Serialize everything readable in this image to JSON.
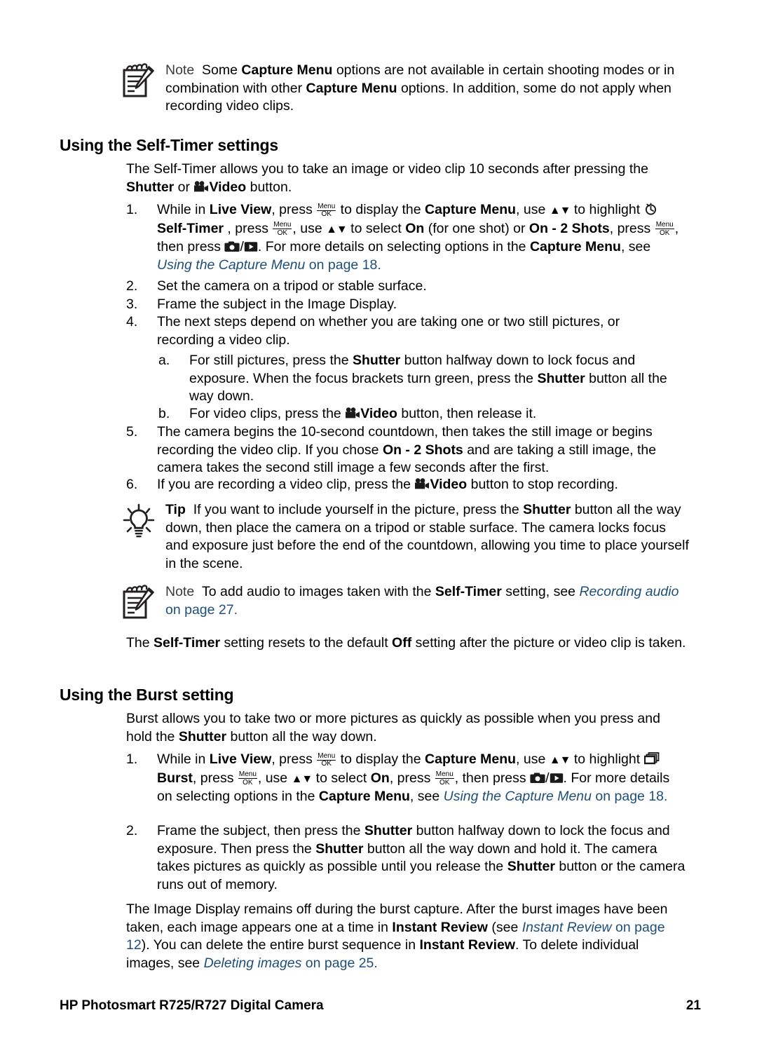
{
  "document": {
    "footer_title": "HP Photosmart R725/R727 Digital Camera",
    "page_number": "21",
    "link_color": "#1f4e79"
  },
  "note_top": {
    "icon": "note-pad-pencil-icon",
    "label": "Note",
    "text_1": "Some ",
    "bold_1": "Capture Menu",
    "text_2": " options are not available in certain shooting modes or in combination with other ",
    "bold_2": "Capture Menu",
    "text_3": " options. In addition, some do not apply when recording video clips."
  },
  "section_self_timer": {
    "heading": "Using the Self-Timer settings",
    "intro": {
      "text_1": "The Self-Timer allows you to take an image or video clip 10 seconds after pressing the ",
      "bold_1": "Shutter",
      "text_2": " or ",
      "video_icon": "video-camera-icon",
      "bold_2": "Video",
      "text_3": " button."
    },
    "steps": [
      {
        "marker": "1.",
        "parts": {
          "t1": "While in ",
          "b1": "Live View",
          "t2": ", press ",
          "menu_icon": {
            "top": "Menu",
            "bottom": "OK"
          },
          "t3": " to display the ",
          "b2": "Capture Menu",
          "t4": ", use ",
          "arrows": "▲▼",
          "t5": " to highlight ",
          "selftimer_icon": "stopwatch-self-timer-icon",
          "b3": "Self-Timer",
          "t6": " , press ",
          "t7": ", use ",
          "t8": " to select ",
          "b4": "On",
          "t9": " (for one shot) or ",
          "b5": "On - 2 Shots",
          "t10": ", press ",
          "t11": ", then press ",
          "camera_icon": "still-camera-icon",
          "slash": "/",
          "playback_icon": "playback-icon",
          "t12": ". For more details on selecting options in the ",
          "b6": "Capture Menu",
          "t13": ", see ",
          "link": "Using the Capture Menu",
          "t14": " on page 18."
        }
      },
      {
        "marker": "2.",
        "text": "Set the camera on a tripod or stable surface."
      },
      {
        "marker": "3.",
        "text": "Frame the subject in the Image Display."
      },
      {
        "marker": "4.",
        "text": "The next steps depend on whether you are taking one or two still pictures, or recording a video clip."
      }
    ],
    "substeps": [
      {
        "marker": "a.",
        "t1": "For still pictures, press the ",
        "b1": "Shutter",
        "t2": " button halfway down to lock focus and exposure. When the focus brackets turn green, press the ",
        "b2": "Shutter",
        "t3": " button all the way down."
      },
      {
        "marker": "b.",
        "t1": "For video clips, press the ",
        "video_icon": "video-camera-icon",
        "b1": "Video",
        "t2": " button, then release it."
      }
    ],
    "steps_after": [
      {
        "marker": "5.",
        "t1": "The camera begins the 10-second countdown, then takes the still image or begins recording the video clip. If you chose ",
        "b1": "On - 2 Shots",
        "t2": " and are taking a still image, the camera takes the second still image a few seconds after the first."
      },
      {
        "marker": "6.",
        "t1": "If you are recording a video clip, press the ",
        "video_icon": "video-camera-icon",
        "b1": "Video",
        "t2": " button to stop recording."
      }
    ],
    "tip": {
      "icon": "lightbulb-tip-icon",
      "label": "Tip",
      "t1": "If you want to include yourself in the picture, press the ",
      "b1": "Shutter",
      "t2": " button all the way down, then place the camera on a tripod or stable surface. The camera locks focus and exposure just before the end of the countdown, allowing you time to place yourself in the scene."
    },
    "note_bottom": {
      "icon": "note-pad-pencil-icon",
      "label": "Note",
      "t1": "To add audio to images taken with the ",
      "b1": "Self-Timer",
      "t2": " setting, see ",
      "link": "Recording audio",
      "t3": " on page 27."
    },
    "closing": {
      "t1": "The ",
      "b1": "Self-Timer",
      "t2": " setting resets to the default ",
      "b2": "Off",
      "t3": " setting after the picture or video clip is taken."
    }
  },
  "section_burst": {
    "heading": "Using the Burst setting",
    "intro": {
      "t1": "Burst allows you to take two or more pictures as quickly as possible when you press and hold the ",
      "b1": "Shutter",
      "t2": " button all the way down."
    },
    "steps": [
      {
        "marker": "1.",
        "parts": {
          "t1": "While in ",
          "b1": "Live View",
          "t2": ", press ",
          "menu_icon": {
            "top": "Menu",
            "bottom": "OK"
          },
          "t3": " to display the ",
          "b2": "Capture Menu",
          "t4": ", use ",
          "arrows": "▲▼",
          "t5": " to highlight ",
          "burst_icon": "burst-frames-icon",
          "b3": "Burst",
          "t6": ", press ",
          "t7": ", use ",
          "t8": " to select ",
          "b4": "On",
          "t9": ", press ",
          "t10": ", then press ",
          "camera_icon": "still-camera-icon",
          "slash": "/",
          "playback_icon": "playback-icon",
          "t11": ". For more details on selecting options in the ",
          "b5": "Capture Menu",
          "t12": ", see ",
          "link": "Using the Capture Menu",
          "t13": " on page 18."
        }
      },
      {
        "marker": "2.",
        "t1": "Frame the subject, then press the ",
        "b1": "Shutter",
        "t2": " button halfway down to lock the focus and exposure. Then press the ",
        "b2": "Shutter",
        "t3": " button all the way down and hold it. The camera takes pictures as quickly as possible until you release the ",
        "b3": "Shutter",
        "t4": " button or the camera runs out of memory."
      }
    ],
    "closing": {
      "t1": "The Image Display remains off during the burst capture. After the burst images have been taken, each image appears one at a time in ",
      "b1": "Instant Review",
      "t2": " (see ",
      "link1": "Instant Review",
      "t3": " on page 12",
      "t4": "). You can delete the entire burst sequence in ",
      "b2": "Instant Review",
      "t5": ". To delete individual images, see ",
      "link2": "Deleting images",
      "t6": " on page 25."
    }
  }
}
